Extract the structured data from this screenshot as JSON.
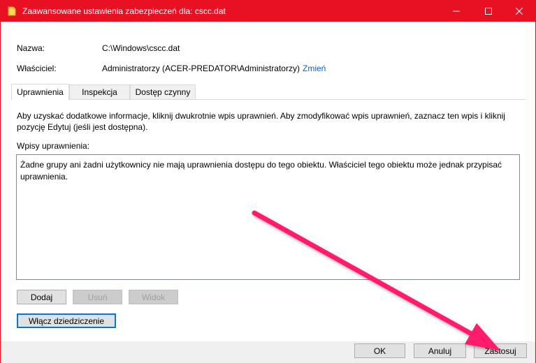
{
  "window": {
    "title": "Zaawansowane ustawienia zabezpieczeń dla: cscc.dat",
    "accent_color": "#e81123"
  },
  "fields": {
    "name_label": "Nazwa:",
    "name_value": "C:\\Windows\\cscc.dat",
    "owner_label": "Właściciel:",
    "owner_value": "Administratorzy (ACER-PREDATOR\\Administratorzy)",
    "owner_change_link": "Zmień"
  },
  "tabs": [
    {
      "label": "Uprawnienia",
      "active": true
    },
    {
      "label": "Inspekcja",
      "active": false
    },
    {
      "label": "Dostęp czynny",
      "active": false
    }
  ],
  "permissions": {
    "description": "Aby uzyskać dodatkowe informacje, kliknij dwukrotnie wpis uprawnień. Aby zmodyfikować wpis uprawnień, zaznacz ten wpis i kliknij pozycję Edytuj (jeśli jest dostępna).",
    "entries_label": "Wpisy uprawnienia:",
    "entries_message": "Żadne grupy ani żadni użytkownicy nie mają uprawnienia dostępu do tego obiektu. Właściciel tego obiektu może jednak przypisać uprawnienia.",
    "add_button": "Dodaj",
    "remove_button": "Usuń",
    "view_button": "Widok",
    "inheritance_button": "Włącz dziedziczenie"
  },
  "footer": {
    "ok_button": "OK",
    "cancel_button": "Anuluj",
    "apply_button": "Zastosuj"
  },
  "annotation": {
    "arrow_color": "#ff1c6c"
  }
}
